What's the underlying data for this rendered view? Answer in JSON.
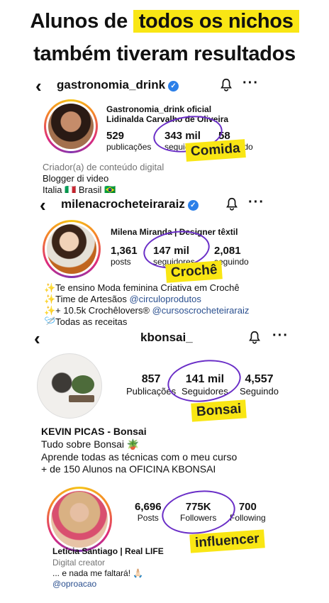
{
  "headline": {
    "prefix": "Alunos de",
    "highlight": "todos os nichos",
    "line2": "também tiveram resultados"
  },
  "profiles": [
    {
      "username": "gastronomia_drink",
      "verified": true,
      "display_name_1": "Gastronomia_drink oficial",
      "display_name_2": "Lidinalda Carvalho de Oliveira",
      "stats": [
        {
          "value": "529",
          "label": "publicações"
        },
        {
          "value": "343 mil",
          "label": "seguidores"
        },
        {
          "value": "58",
          "label": "seguindo"
        }
      ],
      "sticker": "Comida",
      "bio": [
        "Criador(a) de conteúdo digital",
        "Blogger di video",
        "Italia 🇮🇹 Brasil 🇧🇷"
      ]
    },
    {
      "username": "milenacrocheteiraraiz",
      "verified": true,
      "display_name_1": "Milena Miranda | Designer têxtil",
      "stats": [
        {
          "value": "1,361",
          "label": "posts"
        },
        {
          "value": "147 mil",
          "label": "seguidores"
        },
        {
          "value": "2,081",
          "label": "seguindo"
        }
      ],
      "sticker": "Crochê",
      "bio": [
        "✨Te ensino Moda feminina Criativa em Crochê",
        "✨Time de Artesãos ",
        "✨+ 10.5k Crochêlovers® ",
        "🪡Todas as receitas"
      ],
      "bio_links": [
        "@circuloprodutos",
        "@cursoscrocheteiraraiz"
      ]
    },
    {
      "username": "kbonsai_",
      "verified": false,
      "stats": [
        {
          "value": "857",
          "label": "Publicações"
        },
        {
          "value": "141 mil",
          "label": "Seguidores"
        },
        {
          "value": "4,557",
          "label": "Seguindo"
        }
      ],
      "sticker": "Bonsai",
      "name": "KEVIN PICAS - Bonsai",
      "bio": [
        "Tudo sobre Bonsai 🪴",
        "Aprende todas as técnicas com o meu curso",
        "+ de 150 Alunos na OFICINA KBONSAI"
      ]
    },
    {
      "username": "",
      "stats": [
        {
          "value": "6,696",
          "label": "Posts"
        },
        {
          "value": "775K",
          "label": "Followers"
        },
        {
          "value": "700",
          "label": "Following"
        }
      ],
      "sticker": "influencer",
      "name": "Letícia Santiago | Real LIFE",
      "bio": [
        "Digital creator",
        "... e nada me faltará! 🙏🏻"
      ],
      "bio_link": "@oproacao"
    }
  ],
  "icons": {
    "back": "‹",
    "verified": "✓",
    "more": "···"
  },
  "colors": {
    "highlight": "#f9e614",
    "circle": "#6a2ec7",
    "verified": "#2b7fe8"
  }
}
